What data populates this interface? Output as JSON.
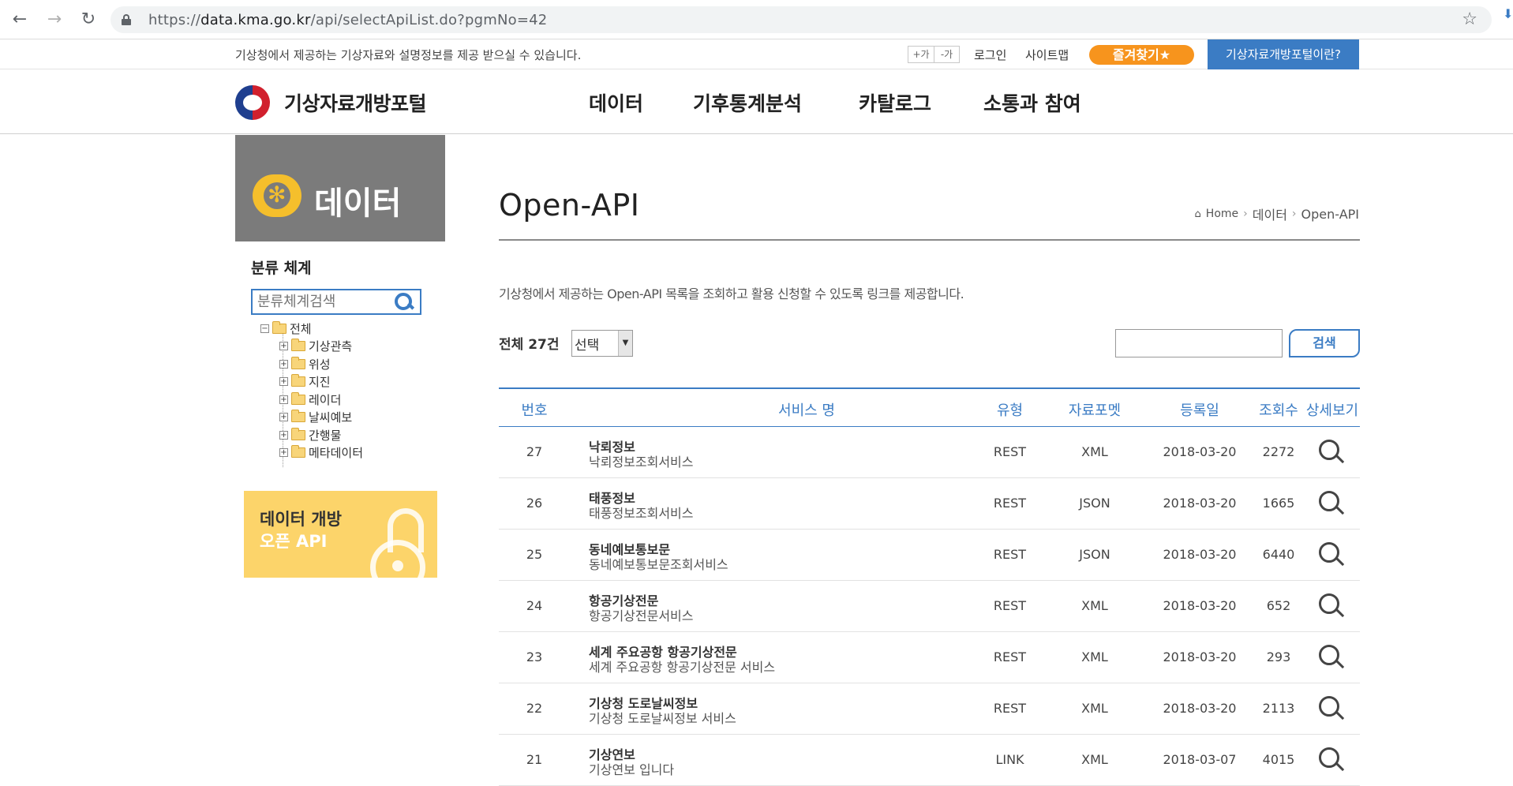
{
  "browser": {
    "url_prefix": "https://",
    "url_host": "data.kma.go.kr",
    "url_path": "/api/selectApiList.do?pgmNo=42",
    "back_icon": "arrow-left",
    "forward_icon": "arrow-right",
    "reload_icon": "reload",
    "bookmark_icon": "star"
  },
  "util": {
    "intro": "기상청에서 제공하는 기상자료와 설명정보를 제공 받으실 수 있습니다.",
    "font_plus": "+가",
    "font_minus": "-가",
    "login": "로그인",
    "sitemap": "사이트맵",
    "favorite": "즐겨찾기★",
    "about": "기상자료개방포털이란?"
  },
  "header": {
    "logo_text": "기상자료개방포털",
    "nav": [
      "데이터",
      "기후통계분석",
      "카탈로그",
      "소통과 참여"
    ]
  },
  "sidebar": {
    "banner_title": "데이터",
    "taxonomy_title": "분류 체계",
    "search_placeholder": "분류체계검색",
    "tree_root": "전체",
    "tree_items": [
      "기상관측",
      "위성",
      "지진",
      "레이더",
      "날씨예보",
      "간행물",
      "메타데이터"
    ],
    "open_banner_line1": "데이터 개방",
    "open_banner_line2": "오픈 API"
  },
  "main": {
    "title": "Open-API",
    "breadcrumb": [
      "Home",
      "데이터",
      "Open-API"
    ],
    "intro": "기상청에서 제공하는 Open-API 목록을 조회하고 활용 신청할 수 있도록 링크를 제공합니다.",
    "total_label": "전체 27건",
    "select_value": "선택",
    "search_button": "검색",
    "columns": [
      "번호",
      "서비스 명",
      "유형",
      "자료포멧",
      "등록일",
      "조회수",
      "상세보기"
    ],
    "rows": [
      {
        "num": "27",
        "name": "낙뢰정보",
        "desc": "낙뢰정보조회서비스",
        "type": "REST",
        "format": "XML",
        "date": "2018-03-20",
        "views": "2272"
      },
      {
        "num": "26",
        "name": "태풍정보",
        "desc": "태풍정보조회서비스",
        "type": "REST",
        "format": "JSON",
        "date": "2018-03-20",
        "views": "1665"
      },
      {
        "num": "25",
        "name": "동네예보통보문",
        "desc": "동네예보통보문조회서비스",
        "type": "REST",
        "format": "JSON",
        "date": "2018-03-20",
        "views": "6440"
      },
      {
        "num": "24",
        "name": "항공기상전문",
        "desc": "항공기상전문서비스",
        "type": "REST",
        "format": "XML",
        "date": "2018-03-20",
        "views": "652"
      },
      {
        "num": "23",
        "name": "세계 주요공항 항공기상전문",
        "desc": "세계 주요공항 항공기상전문 서비스",
        "type": "REST",
        "format": "XML",
        "date": "2018-03-20",
        "views": "293"
      },
      {
        "num": "22",
        "name": "기상청 도로날씨정보",
        "desc": "기상청 도로날씨정보 서비스",
        "type": "REST",
        "format": "XML",
        "date": "2018-03-20",
        "views": "2113"
      },
      {
        "num": "21",
        "name": "기상연보",
        "desc": "기상연보 입니다",
        "type": "LINK",
        "format": "XML",
        "date": "2018-03-07",
        "views": "4015"
      }
    ]
  },
  "colors": {
    "accent_blue": "#3b7cc4",
    "favorite_orange": "#f7941d",
    "sidebar_gray": "#7b7b7b",
    "banner_yellow": "#fcd46a"
  }
}
